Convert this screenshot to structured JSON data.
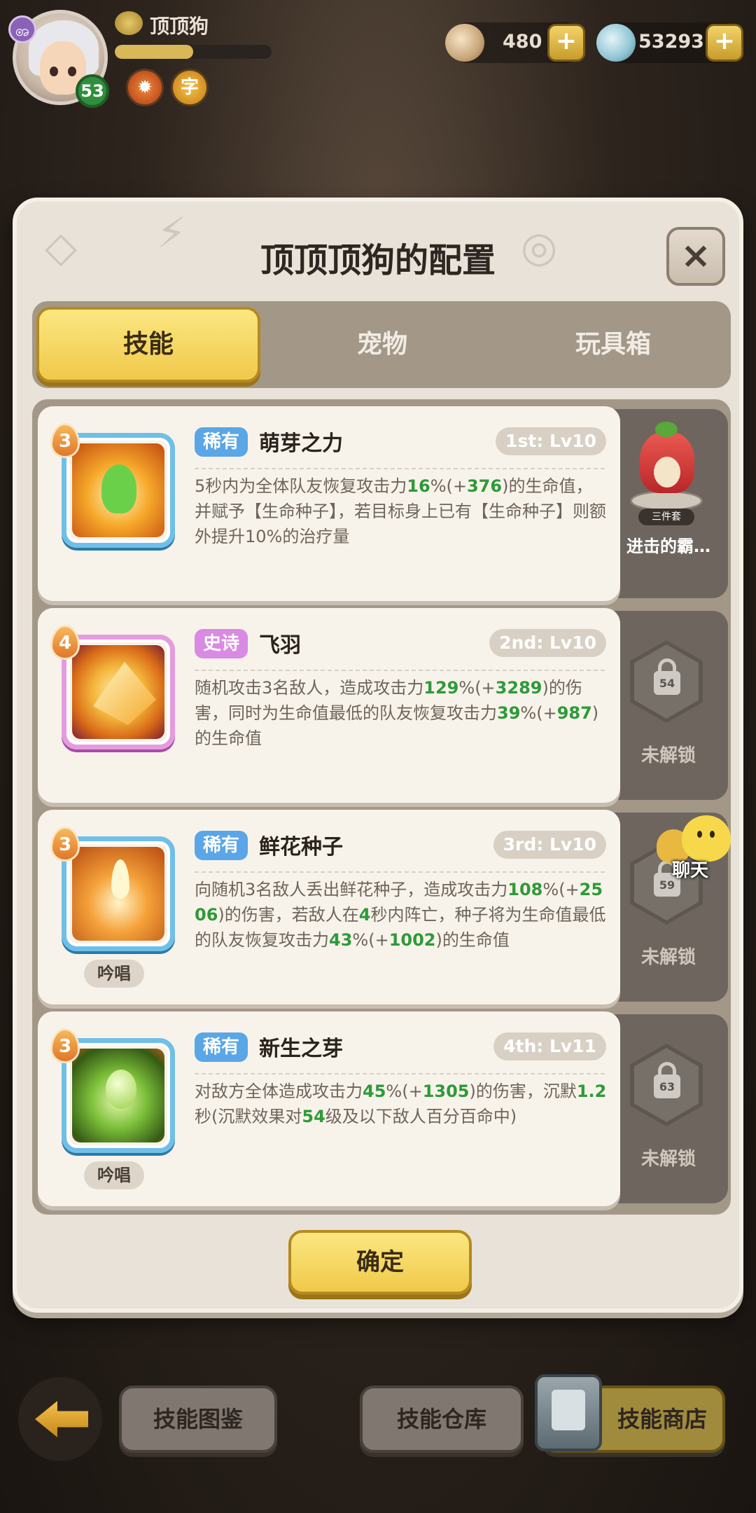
{
  "player": {
    "name": "顶顶狗",
    "level": "53",
    "avatar_badge": "ꩨ",
    "exp_fraction": 0.5,
    "buffs": [
      "✹",
      "字"
    ]
  },
  "currencies": [
    {
      "icon": "shell-icon",
      "value": "480",
      "plus": "+"
    },
    {
      "icon": "gem-icon",
      "value": "53293",
      "plus": "+"
    }
  ],
  "panel": {
    "title": "顶顶顶狗的配置",
    "close": "×",
    "tabs": [
      "技能",
      "宠物",
      "玩具箱"
    ],
    "confirm": "确定"
  },
  "skills": [
    {
      "stars": "3",
      "rarity": "稀有",
      "name": "萌芽之力",
      "slot": "1st: Lv10",
      "chant": "",
      "desc": [
        "5秒内为全体队友恢复攻击力",
        "16",
        "%(+",
        "376",
        ")的生命值，并赋予【生命种子】，若目标身上已有【生命种子】则额外提升10%的治疗量"
      ],
      "side": {
        "type": "pet",
        "tag": "三件套",
        "name": "进击的霸…"
      }
    },
    {
      "stars": "4",
      "rarity": "史诗",
      "name": "飞羽",
      "slot": "2nd: Lv10",
      "chant": "",
      "desc": [
        "随机攻击3名敌人，造成攻击力",
        "129",
        "%(+",
        "3289",
        ")的伤害，同时为生命值最低的队友恢复攻击力",
        "39",
        "%(+",
        "987",
        ")的生命值"
      ],
      "side": {
        "type": "lock",
        "level": "54",
        "text": "未解锁"
      }
    },
    {
      "stars": "3",
      "rarity": "稀有",
      "name": "鲜花种子",
      "slot": "3rd: Lv10",
      "chant": "吟唱",
      "desc": [
        "向随机3名敌人丢出鲜花种子，造成攻击力",
        "108",
        "%(+",
        "2506",
        ")的伤害，若敌人在",
        "4",
        "秒内阵亡，种子将为生命值最低的队友恢复攻击力",
        "43",
        "%(+",
        "1002",
        ")的生命值"
      ],
      "side": {
        "type": "lock",
        "level": "59",
        "text": "未解锁"
      }
    },
    {
      "stars": "3",
      "rarity": "稀有",
      "name": "新生之芽",
      "slot": "4th: Lv11",
      "chant": "吟唱",
      "desc": [
        "对敌方全体造成攻击力",
        "45",
        "%(+",
        "1305",
        ")的伤害，沉默",
        "1.2",
        "秒(沉默效果对",
        "54",
        "级及以下敌人百分百命中)"
      ],
      "side": {
        "type": "lock",
        "level": "63",
        "text": "未解锁"
      }
    }
  ],
  "chat": {
    "label": "聊天"
  },
  "bottom_nav": {
    "back": "←",
    "buttons": [
      "技能图鉴",
      "技能仓库",
      "技能商店"
    ]
  }
}
